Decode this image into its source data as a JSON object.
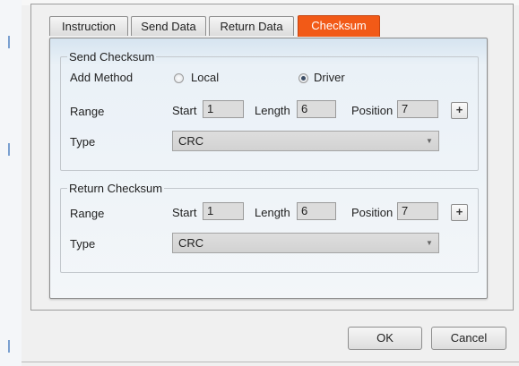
{
  "tabs": [
    {
      "label": "Instruction",
      "active": false
    },
    {
      "label": "Send Data",
      "active": false
    },
    {
      "label": "Return Data",
      "active": false
    },
    {
      "label": "Checksum",
      "active": true
    }
  ],
  "send_checksum": {
    "title": "Send Checksum",
    "add_method_label": "Add Method",
    "options": [
      {
        "label": "Local",
        "selected": false
      },
      {
        "label": "Driver",
        "selected": true
      }
    ],
    "range_label": "Range",
    "start_label": "Start",
    "start_value": "1",
    "length_label": "Length",
    "length_value": "6",
    "position_label": "Position",
    "position_value": "7",
    "plus_label": "+",
    "type_label": "Type",
    "type_value": "CRC"
  },
  "return_checksum": {
    "title": "Return Checksum",
    "range_label": "Range",
    "start_label": "Start",
    "start_value": "1",
    "length_label": "Length",
    "length_value": "6",
    "position_label": "Position",
    "position_value": "7",
    "plus_label": "+",
    "type_label": "Type",
    "type_value": "CRC"
  },
  "buttons": {
    "ok": "OK",
    "cancel": "Cancel"
  },
  "colors": {
    "active_tab": "#f25a17",
    "panel_top": "#d6e4f0"
  }
}
